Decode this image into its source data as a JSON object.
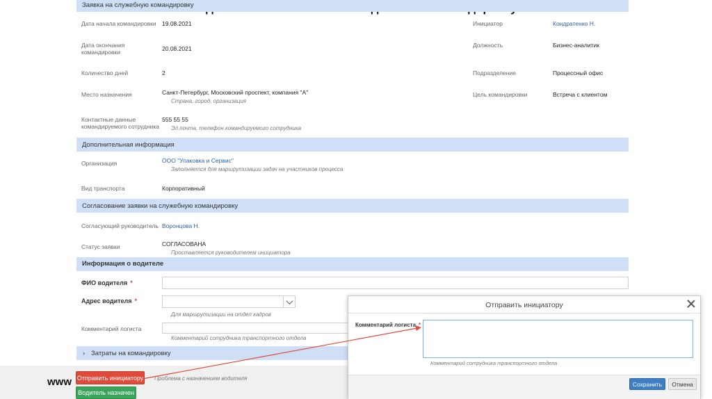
{
  "page_title": "Задача логиста «Назначить водителя на командировку»",
  "sections": {
    "trip": "Заявка на служебную командировку",
    "additional": "Дополнительная информация",
    "approval": "Согласование заявки на служебную командировку",
    "driver": "Информация о водителе",
    "costs": "Затраты на командировку"
  },
  "trip": {
    "start_label": "Дата начала командировки",
    "start_value": "19.08.2021",
    "end_label_1": "Дата окончания",
    "end_label_2": "командировки",
    "end_value": "20.08.2021",
    "days_label": "Количество дней",
    "days_value": "2",
    "dest_label": "Место назначения",
    "dest_value": "Санкт-Петербург, Московский проспект, компания \"А\"",
    "dest_hint": "Страна, город, организация",
    "contact_label_1": "Контактные данные",
    "contact_label_2": "командируемого сотрудника",
    "contact_value": "555 55 55",
    "contact_hint": "Эл.почта, телефон командируемого сотрудника",
    "initiator_label": "Инициатор",
    "initiator_value": "Кондратенко Н.",
    "position_label": "Должность",
    "position_value": "Бизнес-аналитик",
    "department_label": "Подразделение",
    "department_value": "Процессный офис",
    "purpose_label": "Цель командировки",
    "purpose_value": "Встреча с клиентом"
  },
  "additional": {
    "org_label": "Организация",
    "org_value": "ООО \"Упаковка и Сервис\"",
    "org_hint": "Заполняется для маршрутизации задач на участников процесса",
    "transport_label": "Вид транспорта",
    "transport_value": "Корпоративный"
  },
  "approval": {
    "manager_label": "Согласующий руководитель",
    "manager_value": "Воронцова Н.",
    "status_label": "Статус заявки",
    "status_value": "СОГЛАСОВАНА",
    "status_hint": "Проставляется руководителем инициатора"
  },
  "driver": {
    "name_label": "ФИО водителя",
    "address_label": "Адрес водителя",
    "address_hint": "Для маршрутизации на отдел кадров",
    "comment_label": "Комментарий логиста",
    "comment_hint": "Комментарий сотрудника транспортного отдела",
    "required_mark": "*"
  },
  "bottom": {
    "send_button": "Отправить инициатору",
    "send_hint": "Проблема с назначением водителя",
    "assigned_button": "Водитель назначен",
    "www": "www"
  },
  "dialog": {
    "title": "Отправить инициатору",
    "comment_label": "Комментарий логиста",
    "required_mark": "*",
    "comment_hint": "Комментарий сотрудника транспортного отдела",
    "save_button": "Сохранить",
    "cancel_button": "Отмена"
  },
  "colors": {
    "section_band": "#cfdff5",
    "link": "#2b62a8",
    "send_button": "#e04a3a",
    "assigned_button": "#3aa55a",
    "save_button": "#3e7ec4",
    "arrow": "#e04a3a"
  },
  "icons": {
    "costs_expand": "chevron-right-icon",
    "address_dropdown": "chevron-down-icon",
    "dialog_close": "close-icon"
  }
}
